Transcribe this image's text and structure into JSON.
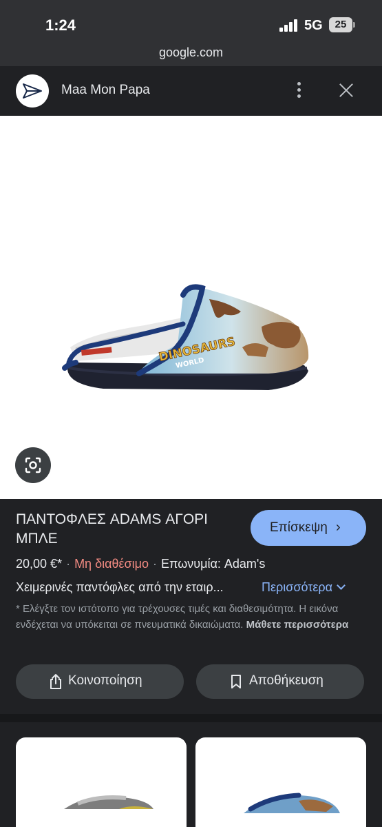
{
  "status_bar": {
    "time": "1:24",
    "network": "5G",
    "battery": "25"
  },
  "url": "google.com",
  "header": {
    "site_name": "Maa Mon Papa",
    "icons": [
      "paper-plane-logo-icon",
      "more-vert-icon",
      "close-icon"
    ]
  },
  "product": {
    "title": "ΠΑΝΤΟΦΛΕΣ ADAMS ΑΓΟΡΙ ΜΠΛΕ",
    "visit_label": "Επίσκεψη",
    "price": "20,00 €*",
    "availability": "Μη διαθέσιμο",
    "brand": "Επωνυμία: Adam's",
    "description": "Χειμερινές παντόφλες από την εταιρ...",
    "more_label": "Περισσότερα",
    "disclaimer": "* Ελέγξτε τον ιστότοπο για τρέχουσες τιμές και διαθεσιμότητα. Η εικόνα ενδέχεται να υπόκειται σε πνευματικά δικαιώματα.",
    "learn_more": "Μάθετε περισσότερα",
    "shoe_print": "DINOSAURS",
    "shoe_print_sub": "WORLD"
  },
  "actions": {
    "share_label": "Κοινοποίηση",
    "save_label": "Αποθήκευση"
  },
  "colors": {
    "accent": "#8ab4f8",
    "unavailable": "#f28b82",
    "background": "#202124"
  }
}
